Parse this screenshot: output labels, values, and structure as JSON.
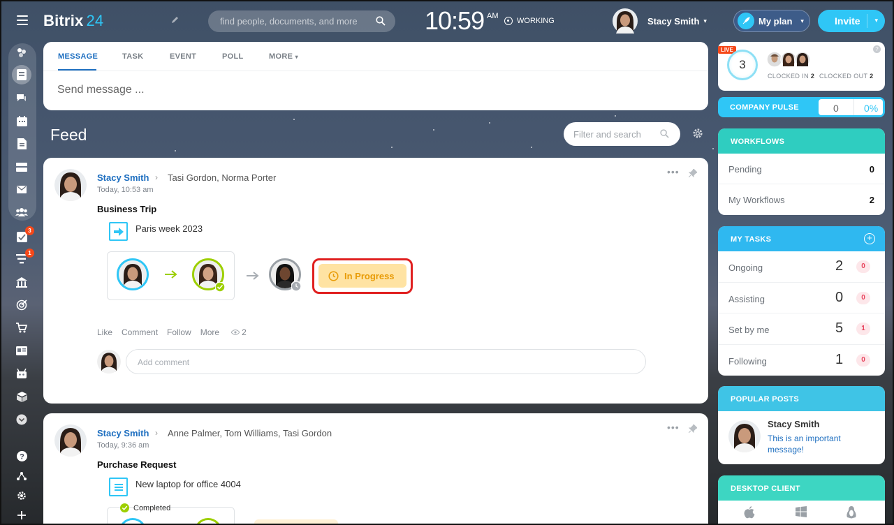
{
  "header": {
    "logo_name": "Bitrix",
    "logo_num": "24",
    "search_placeholder": "find people, documents, and more",
    "time": "10:59",
    "ampm": "AM",
    "status": "WORKING",
    "user_name": "Stacy Smith",
    "my_plan": "My plan",
    "invite": "Invite"
  },
  "sidebar": {
    "badges": {
      "tasks": "3",
      "feed": "1"
    },
    "icons": [
      "rocket-icon",
      "feed-icon",
      "chat-icon",
      "calendar-icon",
      "documents-icon",
      "drive-icon",
      "mail-icon",
      "groups-icon",
      "tasks-icon",
      "crm-icon",
      "company-icon",
      "sites-icon",
      "shop-icon",
      "contact-center-icon",
      "robot-icon",
      "storage-icon",
      "more-icon",
      "help-icon",
      "structure-icon",
      "settings-icon",
      "add-icon"
    ]
  },
  "composer": {
    "tabs": [
      "MESSAGE",
      "TASK",
      "EVENT",
      "POLL",
      "MORE"
    ],
    "placeholder": "Send message ..."
  },
  "feed": {
    "title": "Feed",
    "filter_placeholder": "Filter and search"
  },
  "posts": [
    {
      "author": "Stacy Smith",
      "recipients": "Tasi Gordon, Norma Porter",
      "time": "Today, 10:53 am",
      "title": "Business Trip",
      "workflow_name": "Paris week 2023",
      "status": "In Progress",
      "actions": {
        "like": "Like",
        "comment": "Comment",
        "follow": "Follow",
        "more": "More",
        "views": "2"
      },
      "comment_placeholder": "Add comment"
    },
    {
      "author": "Stacy Smith",
      "recipients": "Anne Palmer, Tom Williams, Tasi Gordon",
      "time": "Today, 9:36 am",
      "title": "Purchase Request",
      "workflow_name": "New laptop for office 4004",
      "step_status": "Completed"
    }
  ],
  "timeman": {
    "live": "LIVE",
    "count": "3",
    "clocked_in_label": "CLOCKED IN",
    "clocked_in": "2",
    "clocked_out_label": "CLOCKED OUT",
    "clocked_out": "2"
  },
  "pulse": {
    "label": "COMPANY PULSE",
    "value": "0",
    "percent": "0%"
  },
  "workflows": {
    "title": "WORKFLOWS",
    "rows": [
      {
        "label": "Pending",
        "value": "0"
      },
      {
        "label": "My Workflows",
        "value": "2"
      }
    ]
  },
  "tasks": {
    "title": "MY TASKS",
    "rows": [
      {
        "label": "Ongoing",
        "value": "2",
        "count": "0"
      },
      {
        "label": "Assisting",
        "value": "0",
        "count": "0"
      },
      {
        "label": "Set by me",
        "value": "5",
        "count": "1"
      },
      {
        "label": "Following",
        "value": "1",
        "count": "0"
      }
    ]
  },
  "popular": {
    "title": "POPULAR POSTS",
    "author": "Stacy Smith",
    "text": "This is an important message!"
  },
  "desktop": {
    "title": "DESKTOP CLIENT"
  },
  "colors": {
    "accent": "#2fc6f6",
    "link": "#1e6fc0",
    "workflows_header": "#2fcdc0",
    "tasks_header": "#2fb8f0",
    "popular_header": "#3fc4e6",
    "desktop_header": "#3dd6c2",
    "in_progress_bg": "#ffe3a3",
    "in_progress_text": "#e89b06",
    "highlight": "#e02020"
  }
}
